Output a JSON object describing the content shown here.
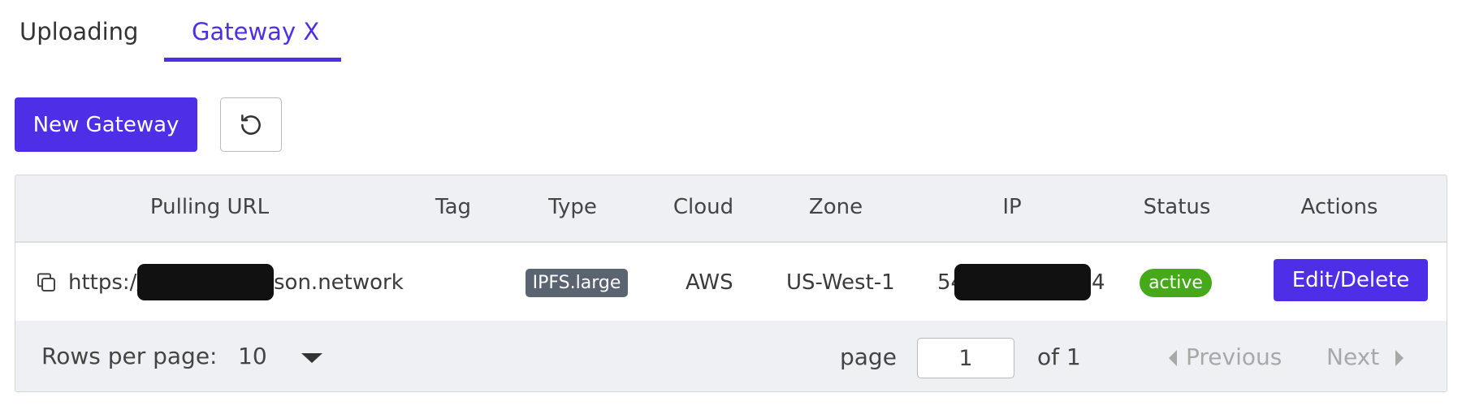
{
  "tabs": [
    {
      "label": "Uploading",
      "active": false
    },
    {
      "label": "Gateway X",
      "active": true
    }
  ],
  "toolbar": {
    "new_gateway_label": "New Gateway",
    "refresh_icon": "refresh-icon"
  },
  "table": {
    "columns": [
      "Pulling URL",
      "Tag",
      "Type",
      "Cloud",
      "Zone",
      "IP",
      "Status",
      "Actions"
    ],
    "rows": [
      {
        "url_prefix": "https://",
        "url_suffix": "son.network",
        "tag": "",
        "type": "IPFS.large",
        "cloud": "AWS",
        "zone": "US-West-1",
        "ip_prefix": "54",
        "ip_suffix": "4",
        "status": "active",
        "action_label": "Edit/Delete"
      }
    ]
  },
  "pagination": {
    "rows_per_page_label": "Rows per page:",
    "rows_per_page_value": "10",
    "page_label": "page",
    "page_value": "1",
    "of_label": "of 1",
    "previous_label": "Previous",
    "next_label": "Next"
  },
  "colors": {
    "accent": "#4f2ee8",
    "status_active": "#45a919",
    "type_badge": "#5a6370",
    "header_bg": "#eff0f3"
  }
}
